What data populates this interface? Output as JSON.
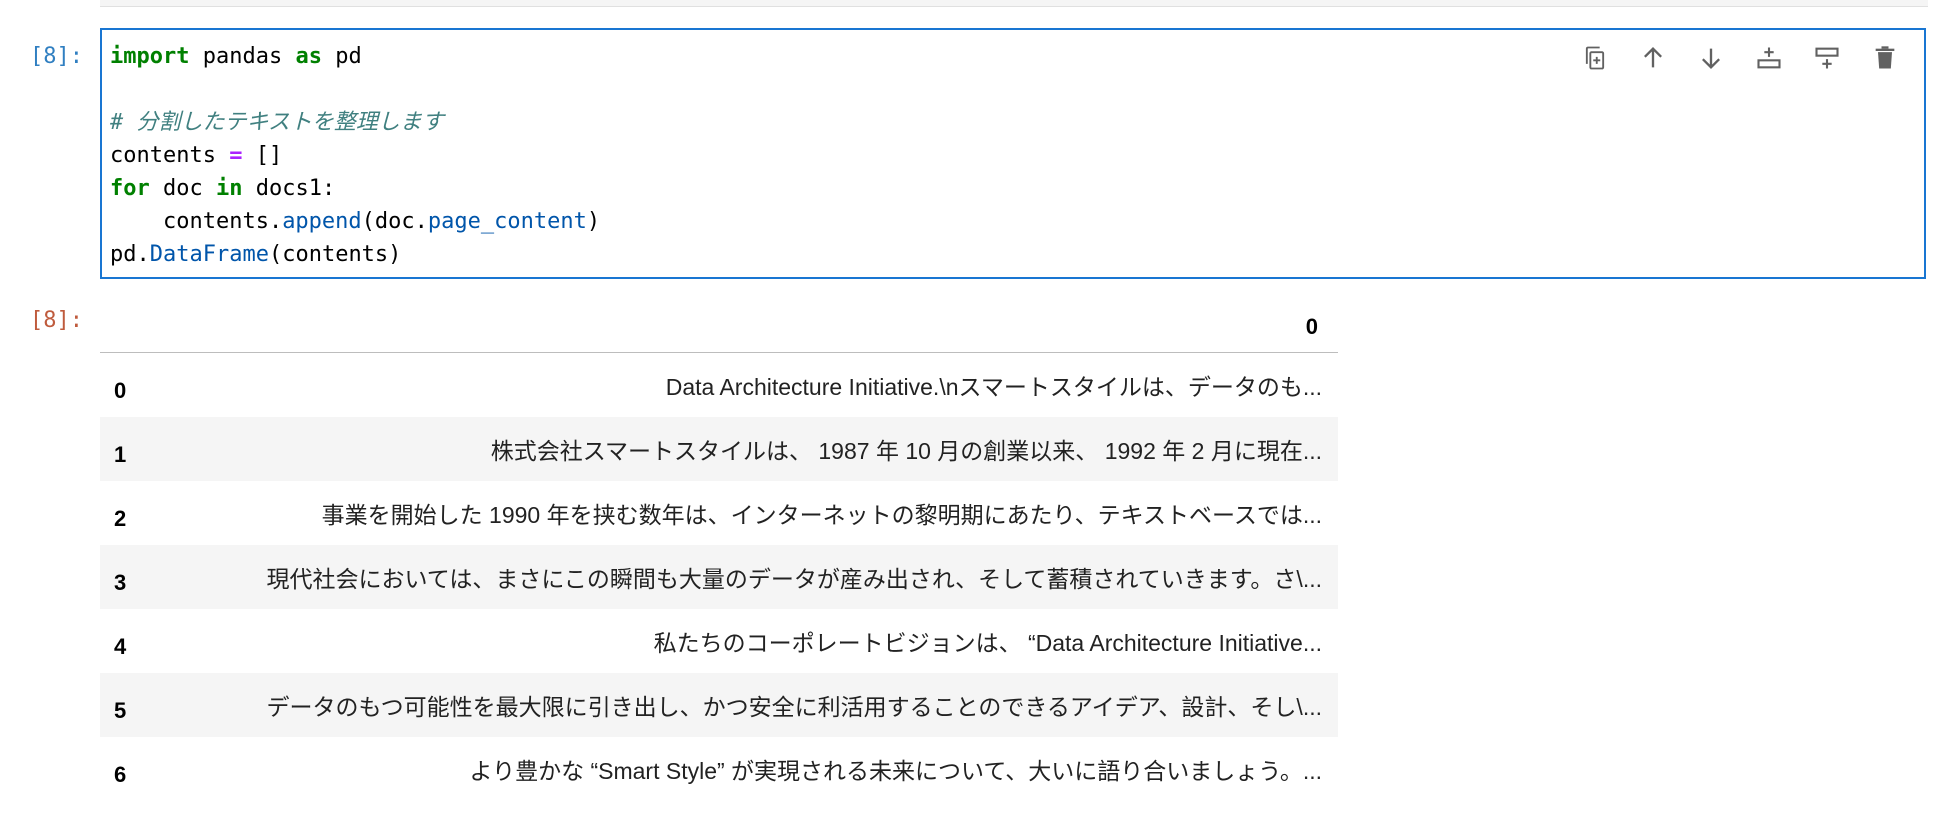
{
  "cell": {
    "in_prompt": "[8]:",
    "out_prompt": "[8]:",
    "code": {
      "l1_kw1": "import",
      "l1_mid": " pandas ",
      "l1_kw2": "as",
      "l1_end": " pd",
      "l3_comment": "# 分割したテキストを整理します",
      "l4_a": "contents ",
      "l4_op": "=",
      "l4_b": " []",
      "l5_kw1": "for",
      "l5_mid": " doc ",
      "l5_kw2": "in",
      "l5_end": " docs1:",
      "l6_a": "    contents.",
      "l6_fn": "append",
      "l6_b": "(doc.",
      "l6_attr": "page_content",
      "l6_c": ")",
      "l7_a": "pd.",
      "l7_fn": "DataFrame",
      "l7_b": "(contents)"
    }
  },
  "toolbar": {
    "icons": [
      "duplicate-icon",
      "move-up-icon",
      "move-down-icon",
      "insert-above-icon",
      "insert-below-icon",
      "delete-icon"
    ]
  },
  "dataframe": {
    "column_header": "0",
    "rows": [
      {
        "index": "0",
        "value": "Data Architecture Initiative.\\nスマートスタイルは、データのも..."
      },
      {
        "index": "1",
        "value": "株式会社スマートスタイルは、 1987 年 10 月の創業以来、 1992 年 2 月に現在..."
      },
      {
        "index": "2",
        "value": "事業を開始した 1990 年を挟む数年は、インターネットの黎明期にあたり、テキストベースでは..."
      },
      {
        "index": "3",
        "value": "現代社会においては、まさにこの瞬間も大量のデータが産み出され、そして蓄積されていきます。さ\\..."
      },
      {
        "index": "4",
        "value": "私たちのコーポレートビジョンは、 “Data Architecture Initiative..."
      },
      {
        "index": "5",
        "value": "データのもつ可能性を最大限に引き出し、かつ安全に利活用することのできるアイデア、設計、そし\\..."
      },
      {
        "index": "6",
        "value": "より豊かな “Smart Style” が実現される未来について、大いに語り合いましょう。..."
      }
    ]
  }
}
